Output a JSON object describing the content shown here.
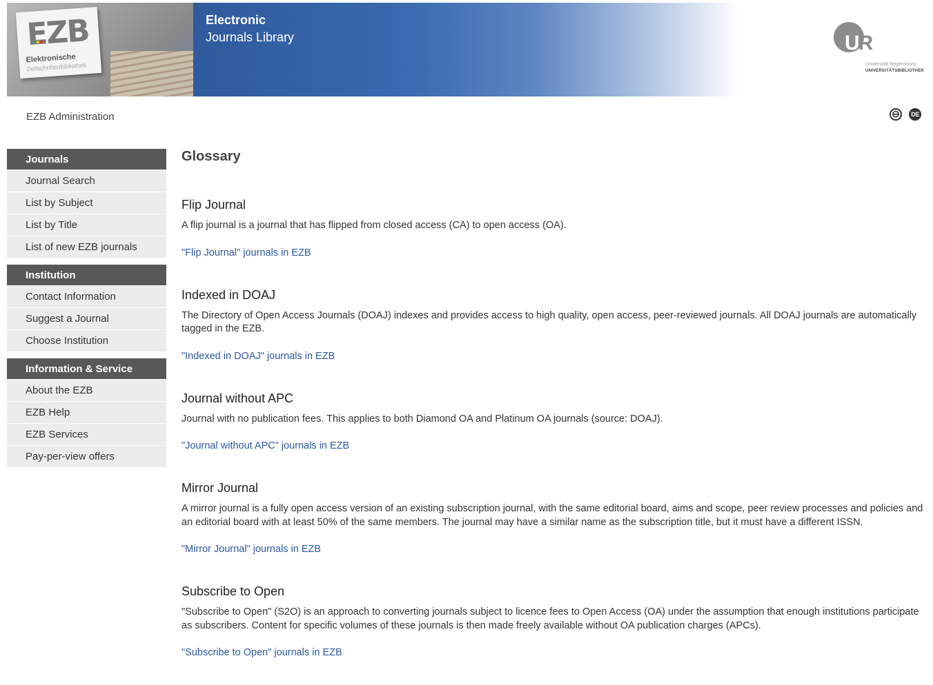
{
  "banner": {
    "logo_text": "EZB",
    "logo_sub1": "Elektronische",
    "logo_sub2": "Zeitschriftenbibliothek",
    "title_line1": "Electronic",
    "title_line2": "Journals Library"
  },
  "ur_logo": {
    "letters_u": "U",
    "letters_r": "R",
    "sub1": "Universität Regensburg",
    "sub2": "UNIVERSITÄTSBIBLIOTHEK"
  },
  "admin_label": "EZB Administration",
  "lang": {
    "minus_icon": "⊖",
    "de_label": "DE"
  },
  "sidebar": {
    "groups": [
      {
        "heading": "Journals",
        "items": [
          "Journal Search",
          "List by Subject",
          "List by Title",
          "List of new EZB journals"
        ]
      },
      {
        "heading": "Institution",
        "items": [
          "Contact Information",
          "Suggest a Journal",
          "Choose Institution"
        ]
      },
      {
        "heading": "Information & Service",
        "items": [
          "About the EZB",
          "EZB Help",
          "EZB Services",
          "Pay-per-view offers"
        ]
      }
    ]
  },
  "main": {
    "title": "Glossary",
    "entries": [
      {
        "heading": "Flip Journal",
        "text": "A flip journal is a journal that has flipped from closed access (CA) to open access (OA).",
        "link": "\"Flip Journal\" journals in EZB"
      },
      {
        "heading": "Indexed in DOAJ",
        "text": "The Directory of Open Access Journals (DOAJ) indexes and provides access to high quality, open access, peer-reviewed journals. All DOAJ journals are automatically tagged in the EZB.",
        "link": "\"Indexed in DOAJ\" journals in EZB"
      },
      {
        "heading": "Journal without APC",
        "text": "Journal with no publication fees. This applies to both Diamond OA and Platinum OA journals (source: DOAJ).",
        "link": "\"Journal without APC\" journals in EZB"
      },
      {
        "heading": "Mirror Journal",
        "text": "A mirror journal is a fully open access version of an existing subscription journal, with the same editorial board, aims and scope, peer review processes and policies and an editorial board with at least 50% of the same members. The journal may have a similar name as the subscription title, but it must have a different ISSN.",
        "link": "\"Mirror Journal\" journals in EZB"
      },
      {
        "heading": "Subscribe to Open",
        "text": "\"Subscribe to Open\" (S2O) is an approach to converting journals subject to licence fees to Open Access (OA) under the assumption that enough institutions participate as subscribers. Content for specific volumes of these journals is then made freely available without OA publication charges (APCs).",
        "link": "\"Subscribe to Open\" journals in EZB"
      }
    ]
  },
  "colors": {
    "nav_heading_bg": "#585858",
    "nav_item_bg": "#ececec",
    "link": "#2c58a0",
    "banner_blue": "#2f5a9c"
  }
}
